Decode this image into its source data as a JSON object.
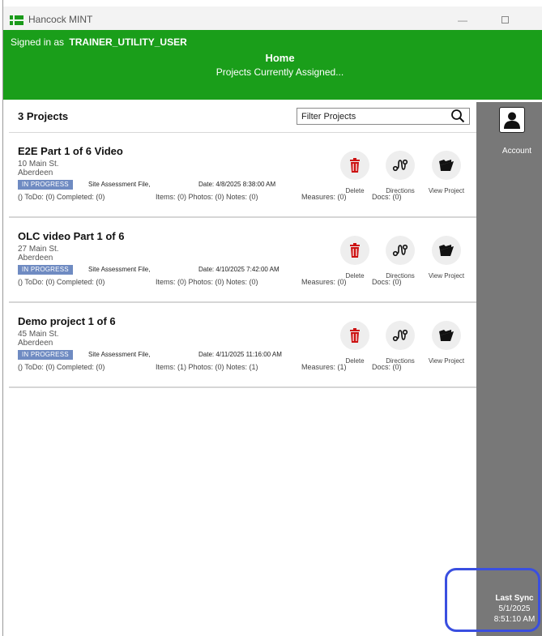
{
  "window": {
    "title": "Hancock MINT",
    "minimize_glyph": "—"
  },
  "header": {
    "signed_in_prefix": "Signed in as",
    "signed_in_user": "TRAINER_UTILITY_USER",
    "title": "Home",
    "subtitle": "Projects Currently Assigned..."
  },
  "list": {
    "count_label": "3 Projects",
    "filter_placeholder": "Filter Projects"
  },
  "actions": {
    "delete": "Delete",
    "directions": "Directions",
    "view": "View Project"
  },
  "projects": [
    {
      "name": "E2E Part 1 of 6 Video",
      "street": "10 Main St.",
      "city": "Aberdeen",
      "status": "IN PROGRESS",
      "type": "Site Assessment File,",
      "date": "Date: 4/8/2025 8:38:00 AM",
      "todo": "() ToDo: (0) Completed: (0)",
      "items": "Items: (0) Photos: (0) Notes: (0)",
      "measures": "Measures: (0)",
      "docs": "Docs: (0)"
    },
    {
      "name": "OLC video Part 1 of 6",
      "street": "27 Main St.",
      "city": "Aberdeen",
      "status": "IN PROGRESS",
      "type": "Site Assessment File,",
      "date": "Date: 4/10/2025 7:42:00 AM",
      "todo": "() ToDo: (0) Completed: (0)",
      "items": "Items: (0) Photos: (0) Notes: (0)",
      "measures": "Measures: (0)",
      "docs": "Docs: (0)"
    },
    {
      "name": "Demo project 1 of 6",
      "street": "45 Main St.",
      "city": "Aberdeen",
      "status": "IN PROGRESS",
      "type": "Site Assessment File,",
      "date": "Date: 4/11/2025 11:16:00 AM",
      "todo": "() ToDo: (0) Completed: (0)",
      "items": "Items: (1) Photos: (0) Notes: (1)",
      "measures": "Measures: (1)",
      "docs": "Docs: (0)"
    }
  ],
  "sidebar": {
    "account_label": "Account",
    "sync_title": "Last Sync",
    "sync_date": "5/1/2025",
    "sync_time": "8:51:10 AM"
  },
  "colors": {
    "header_green": "#1a9e1a",
    "status_badge": "#6f8bc2",
    "delete_red": "#cc1111",
    "sidebar_gray": "#787878",
    "sync_highlight": "#3a4fe0"
  },
  "icons": {
    "app": "mint-logo-icon",
    "search": "search-icon",
    "delete": "trash-icon",
    "directions": "route-icon",
    "view": "folder-open-icon",
    "account": "person-icon"
  }
}
